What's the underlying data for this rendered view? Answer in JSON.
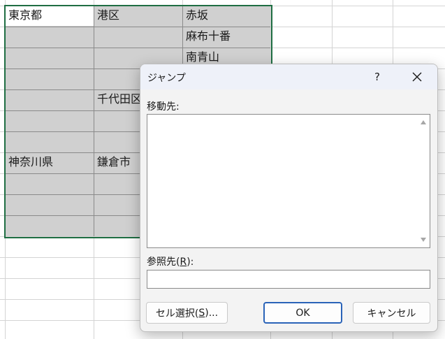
{
  "sheet": {
    "cells": {
      "a1": "東京都",
      "b1": "港区",
      "c1": "赤坂",
      "c2": "麻布十番",
      "c3": "南青山",
      "b5": "千代田区",
      "a8": "神奈川県",
      "b8": "鎌倉市"
    }
  },
  "dialog": {
    "title": "ジャンプ",
    "help_label": "?",
    "goto_label": "移動先:",
    "goto_items": [],
    "reference_label_prefix": "参照先(",
    "reference_label_key": "R",
    "reference_label_suffix": "):",
    "reference_value": "",
    "special_prefix": "セル選択(",
    "special_key": "S",
    "special_suffix": ")...",
    "ok_label": "OK",
    "cancel_label": "キャンセル"
  },
  "colors": {
    "selection_border": "#1f6e43",
    "selection_fill": "#d0d0d0",
    "ok_border": "#2a63b8"
  }
}
